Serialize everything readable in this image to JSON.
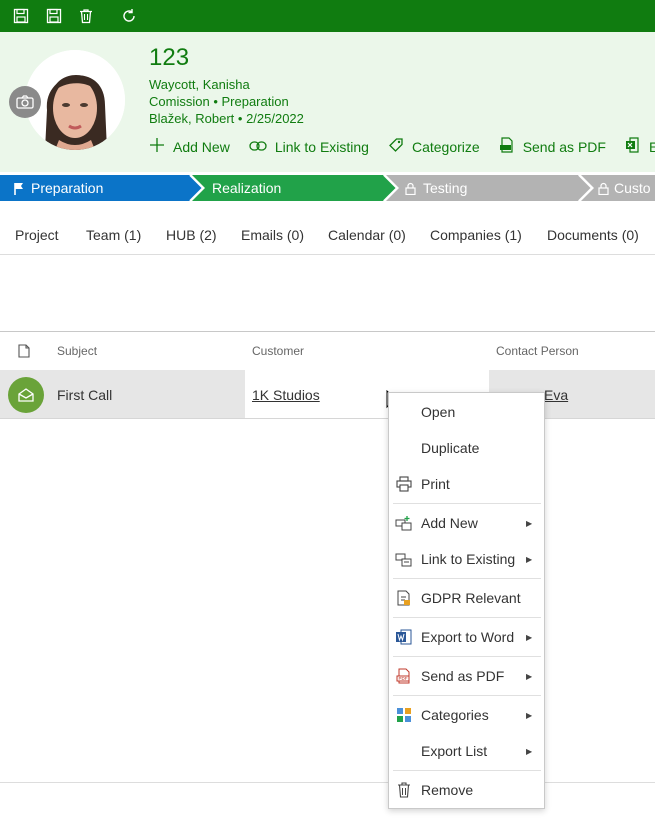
{
  "toolbar": {
    "icons": [
      "save-close-icon",
      "save-icon",
      "delete-icon",
      "refresh-icon"
    ],
    "color": "#107c10"
  },
  "record": {
    "title": "123",
    "owner": "Waycott, Kanisha",
    "type": "Comission",
    "type_stage": "Preparation",
    "responsible": "Blažek, Robert",
    "date": "2/25/2022"
  },
  "actions": {
    "add_new": "Add New",
    "link_existing": "Link to Existing",
    "categorize": "Categorize",
    "send_pdf": "Send as PDF",
    "export": "Ex"
  },
  "stages": [
    {
      "label": "Preparation",
      "color": "#0b74c8"
    },
    {
      "label": "Realization",
      "color": "#21a249"
    },
    {
      "label": "Testing",
      "color": "#b3b3b3"
    },
    {
      "label": "Custo",
      "color": "#b3b3b3"
    }
  ],
  "tabs": [
    "Project",
    "Team (1)",
    "HUB (2)",
    "Emails (0)",
    "Calendar (0)",
    "Companies (1)",
    "Documents (0)"
  ],
  "grid": {
    "columns": [
      "Subject",
      "Customer",
      "Contact Person"
    ],
    "rows": [
      {
        "subject": "First Call",
        "customer": "1K Studios",
        "contact_hidden": "Kolesná, Eva",
        "contact_visible": "Eva"
      }
    ]
  },
  "context_menu": {
    "items": [
      {
        "label": "Open",
        "icon": "",
        "submenu": false
      },
      {
        "label": "Duplicate",
        "icon": "",
        "submenu": false
      },
      {
        "label": "Print",
        "icon": "print-icon",
        "submenu": false
      },
      {
        "label": "Add New",
        "icon": "add-new-icon",
        "submenu": true
      },
      {
        "label": "Link to Existing",
        "icon": "link-existing-icon",
        "submenu": true
      },
      {
        "label": "GDPR Relevant",
        "icon": "gdpr-icon",
        "submenu": false
      },
      {
        "label": "Export to Word",
        "icon": "word-icon",
        "submenu": true
      },
      {
        "label": "Send as PDF",
        "icon": "pdf-icon",
        "submenu": true
      },
      {
        "label": "Categories",
        "icon": "categories-icon",
        "submenu": true
      },
      {
        "label": "Export List",
        "icon": "",
        "submenu": true
      },
      {
        "label": "Remove",
        "icon": "trash-icon",
        "submenu": false
      }
    ]
  }
}
